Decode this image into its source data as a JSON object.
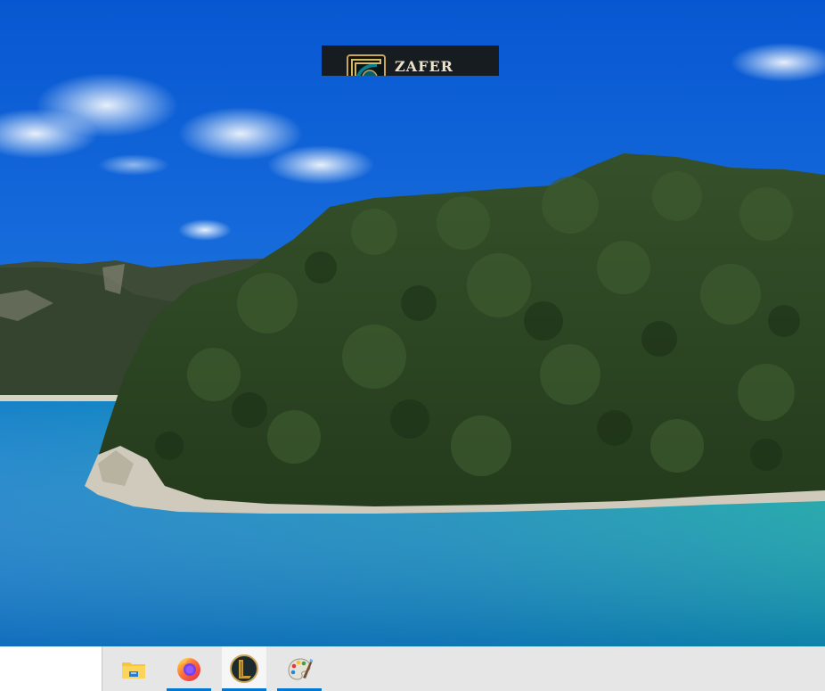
{
  "wallpaper": {
    "colors": {
      "sky_top": "#0a60d8",
      "sky_bottom": "#2b86e6",
      "forest": "#2f4a24",
      "forest_dark": "#1f3518",
      "hill_far": "#3d4d36",
      "rock": "#c9c4b6",
      "water_left": "#1784c8",
      "water_right": "#11a3a4",
      "water_deep": "#0f6fba"
    }
  },
  "notification": {
    "name": "ZAFER",
    "icon": "league-of-legends-icon",
    "background": "#161c1f",
    "text_color": "#ece2c8",
    "frame_color": "#c8a55a"
  },
  "taskbar": {
    "background": "#e6e6e6",
    "accent": "#0078d4",
    "items": [
      {
        "icon": "file-explorer-icon",
        "running": false,
        "active": false
      },
      {
        "icon": "firefox-icon",
        "running": true,
        "active": false
      },
      {
        "icon": "league-of-legends-icon",
        "running": true,
        "active": true
      },
      {
        "icon": "paint-icon",
        "running": true,
        "active": false
      }
    ]
  }
}
